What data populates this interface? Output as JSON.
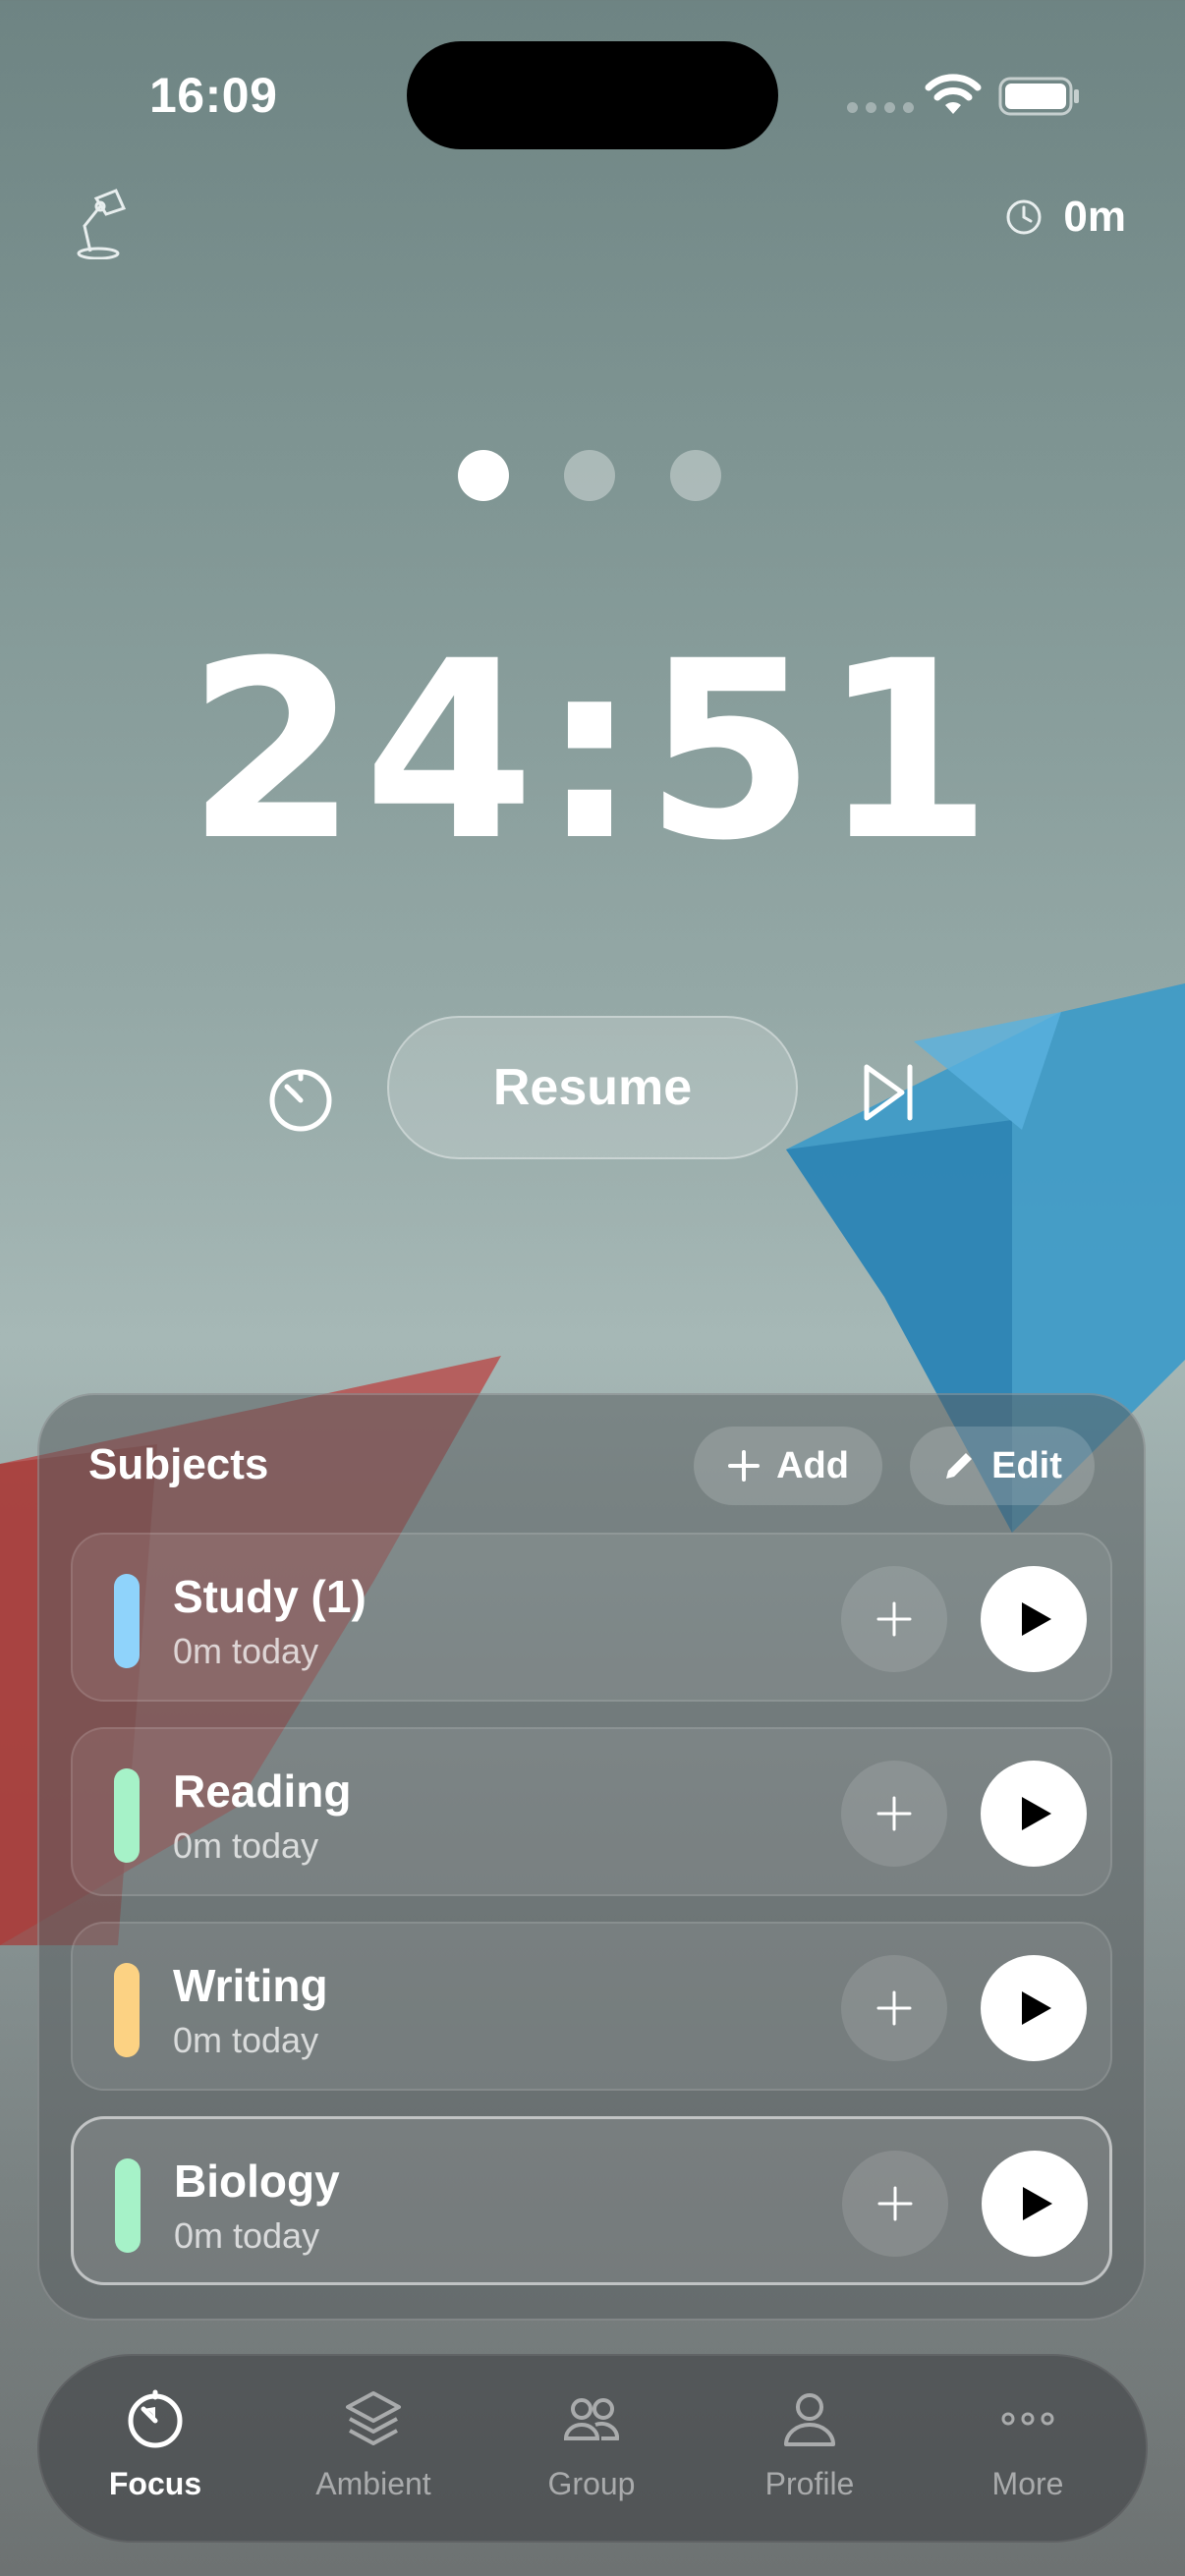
{
  "status_bar": {
    "time": "16:09"
  },
  "header": {
    "total_time": "0m",
    "lamp_icon": "desk-lamp-icon",
    "clock_icon": "clock-icon"
  },
  "pager": {
    "pages": 3,
    "active_index": 0
  },
  "timer": {
    "display": "24:51"
  },
  "controls": {
    "resume_label": "Resume",
    "mode_icon": "timer-icon",
    "skip_icon": "skip-forward-icon"
  },
  "subjects": {
    "title": "Subjects",
    "add_label": "Add",
    "edit_label": "Edit",
    "items": [
      {
        "name": "Study (1)",
        "subtitle": "0m today",
        "color": "#8fd3fb"
      },
      {
        "name": "Reading",
        "subtitle": "0m today",
        "color": "#a6f2c8"
      },
      {
        "name": "Writing",
        "subtitle": "0m today",
        "color": "#fcd283"
      },
      {
        "name": "Biology",
        "subtitle": "0m today",
        "color": "#a6f2c8",
        "selected": true
      }
    ]
  },
  "tabbar": {
    "tabs": [
      {
        "label": "Focus",
        "icon": "focus-timer-icon",
        "active": true
      },
      {
        "label": "Ambient",
        "icon": "layers-icon"
      },
      {
        "label": "Group",
        "icon": "group-icon"
      },
      {
        "label": "Profile",
        "icon": "person-icon"
      },
      {
        "label": "More",
        "icon": "more-icon"
      }
    ]
  },
  "colors": {
    "accent_white": "#ffffff",
    "panel": "#5a5e60"
  }
}
